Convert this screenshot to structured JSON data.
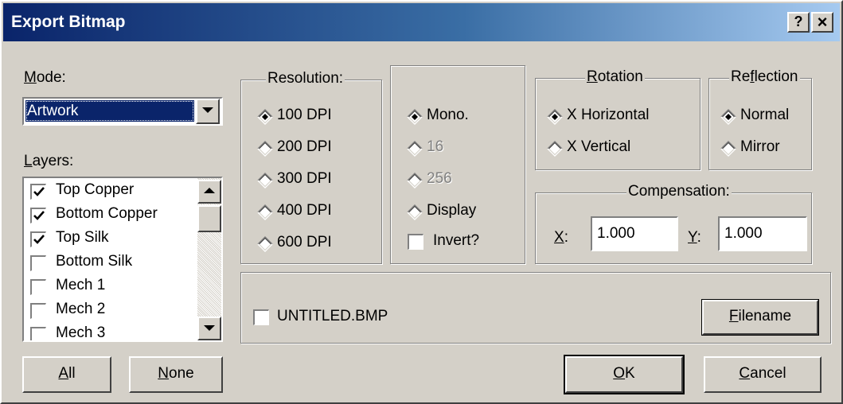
{
  "window": {
    "title": "Export Bitmap",
    "help_btn": "?",
    "close_btn": "×"
  },
  "mode": {
    "label_ul": "M",
    "label_rest": "ode:",
    "value": "Artwork"
  },
  "layers": {
    "label_ul": "L",
    "label_rest": "ayers:",
    "items": [
      {
        "label": "Top Copper",
        "checked": true
      },
      {
        "label": "Bottom Copper",
        "checked": true
      },
      {
        "label": "Top Silk",
        "checked": true
      },
      {
        "label": "Bottom Silk",
        "checked": false
      },
      {
        "label": "Mech 1",
        "checked": false
      },
      {
        "label": "Mech 2",
        "checked": false
      },
      {
        "label": "Mech 3",
        "checked": false
      }
    ],
    "all_ul": "A",
    "all_rest": "ll",
    "none_ul": "N",
    "none_rest": "one"
  },
  "resolution": {
    "title": "Resolution:",
    "options": [
      "100 DPI",
      "200 DPI",
      "300 DPI",
      "400 DPI",
      "600 DPI"
    ],
    "selected_index": 0
  },
  "color": {
    "options": [
      "Mono.",
      "16",
      "256",
      "Display"
    ],
    "selected_index": 0,
    "invert_label": "Invert?",
    "invert_checked": false
  },
  "rotation": {
    "title_ul": "R",
    "title_rest": "otation",
    "options": [
      "X Horizontal",
      "X Vertical"
    ],
    "selected_index": 0
  },
  "reflection": {
    "title_pre": "Re",
    "title_ul": "f",
    "title_rest": "lection",
    "options": [
      "Normal",
      "Mirror"
    ],
    "selected_index": 0
  },
  "compensation": {
    "title": "Compensation:",
    "x_label_ul": "X",
    "x_label_rest": ":",
    "x_value": "1.000",
    "y_label_ul": "Y",
    "y_label_rest": ":",
    "y_value": "1.000"
  },
  "file": {
    "checkbox_label": "UNTITLED.BMP",
    "checked": false,
    "filename_ul": "F",
    "filename_rest": "ilename"
  },
  "buttons": {
    "ok_ul": "O",
    "ok_rest": "K",
    "cancel_ul": "C",
    "cancel_rest": "ancel"
  }
}
